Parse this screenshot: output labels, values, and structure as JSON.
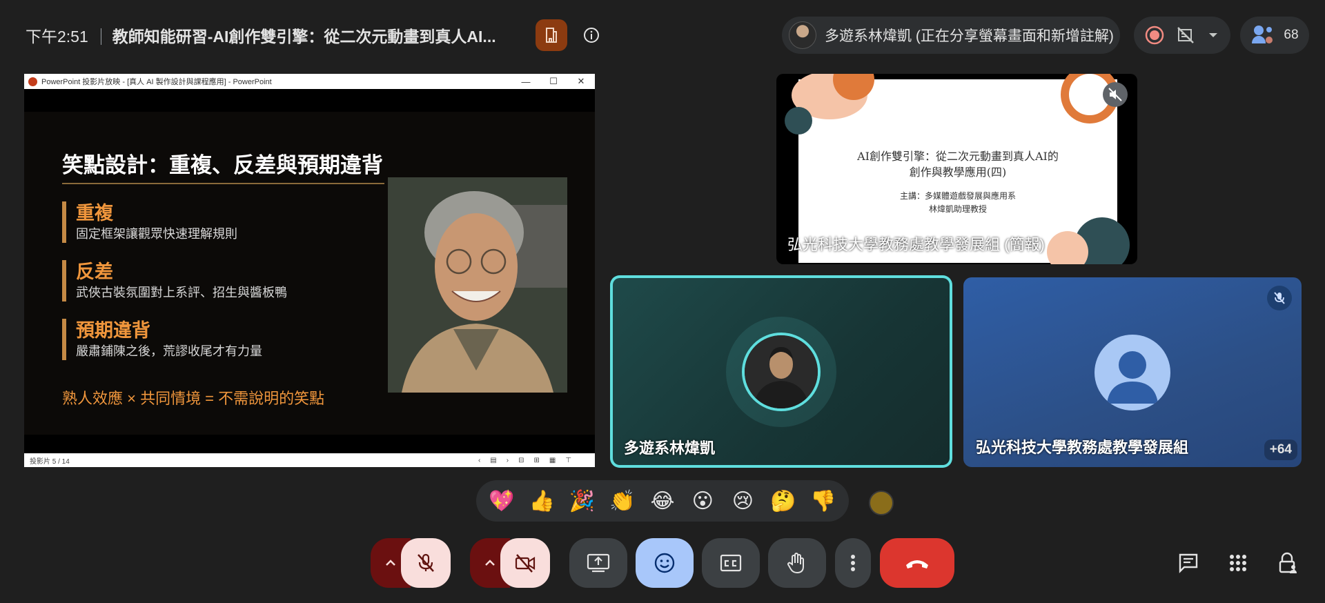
{
  "header": {
    "time": "下午2:51",
    "meeting_title": "教師知能研習-AI創作雙引擎：從二次元動畫到真人AI..."
  },
  "presenter_chip": {
    "text": "多遊系林煒凱 (正在分享螢幕畫面和新增註解)"
  },
  "participants": {
    "count": "68"
  },
  "shared_screen": {
    "window_title": "PowerPoint 投影片放映 - [真人 AI 製作設計與課程應用] - PowerPoint",
    "status_left": "投影片 5 / 14",
    "slide": {
      "title": "笑點設計：重複、反差與預期違背",
      "points": [
        {
          "heading": "重複",
          "desc": "固定框架讓觀眾快速理解規則"
        },
        {
          "heading": "反差",
          "desc": "武俠古裝氛圍對上系評、招生與醬板鴨"
        },
        {
          "heading": "預期違背",
          "desc": "嚴肅鋪陳之後，荒謬收尾才有力量"
        }
      ],
      "footer": "熟人效應 × 共同情境 = 不需說明的笑點"
    }
  },
  "tiles": {
    "presentation": {
      "label": "弘光科技大學教務處教學發展組 (簡報)",
      "slide_title_line1": "AI創作雙引擎：從二次元動畫到真人AI的",
      "slide_title_line2": "創作與教學應用(四)",
      "slide_sub_line1": "主講：多媒體遊戲發展與應用系",
      "slide_sub_line2": "林煒凱助理教授"
    },
    "speaker": {
      "label": "多遊系林煒凱"
    },
    "organizer": {
      "label": "弘光科技大學教務處教學發展組",
      "more": "+64"
    }
  },
  "reactions": [
    "💖",
    "👍",
    "🎉",
    "👏",
    "😂",
    "😮",
    "😢",
    "🤔",
    "👎"
  ],
  "colors": {
    "background": "#1f1f1f",
    "hangup": "#dc362e",
    "active_tile_border": "#5fdede",
    "muted_control": "#f9dedc",
    "emoji_button": "#a8c7fa"
  }
}
